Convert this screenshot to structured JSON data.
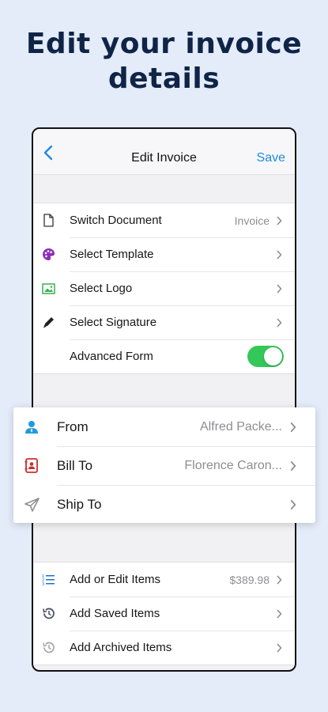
{
  "headline": {
    "line1": "Edit your invoice",
    "line2": "details"
  },
  "nav": {
    "title": "Edit Invoice",
    "save_label": "Save",
    "back_icon": "chevron-left-icon"
  },
  "settings": [
    {
      "label": "Switch Document",
      "value": "Invoice",
      "icon": "document-icon"
    },
    {
      "label": "Select Template",
      "value": "",
      "icon": "palette-icon"
    },
    {
      "label": "Select Logo",
      "value": "",
      "icon": "image-icon"
    },
    {
      "label": "Select Signature",
      "value": "",
      "icon": "pencil-icon"
    },
    {
      "label": "Advanced Form",
      "toggle_on": true
    }
  ],
  "parties": [
    {
      "label": "From",
      "value": "Alfred Packe...",
      "icon": "person-icon",
      "color": "#1d9be0"
    },
    {
      "label": "Bill To",
      "value": "Florence Caron...",
      "icon": "contact-book-icon",
      "color": "#c62f2f"
    },
    {
      "label": "Ship To",
      "value": "",
      "icon": "paper-plane-icon",
      "color": "#8e8e93"
    }
  ],
  "items": [
    {
      "label": "Add or Edit Items",
      "value": "$389.98",
      "icon": "list-icon"
    },
    {
      "label": "Add Saved Items",
      "value": "",
      "icon": "history-icon"
    },
    {
      "label": "Add Archived Items",
      "value": "",
      "icon": "archive-history-icon"
    }
  ],
  "colors": {
    "accent": "#1f8ae0",
    "toggle": "#34c759",
    "background": "#e4ecf9",
    "headline": "#0f2447"
  }
}
